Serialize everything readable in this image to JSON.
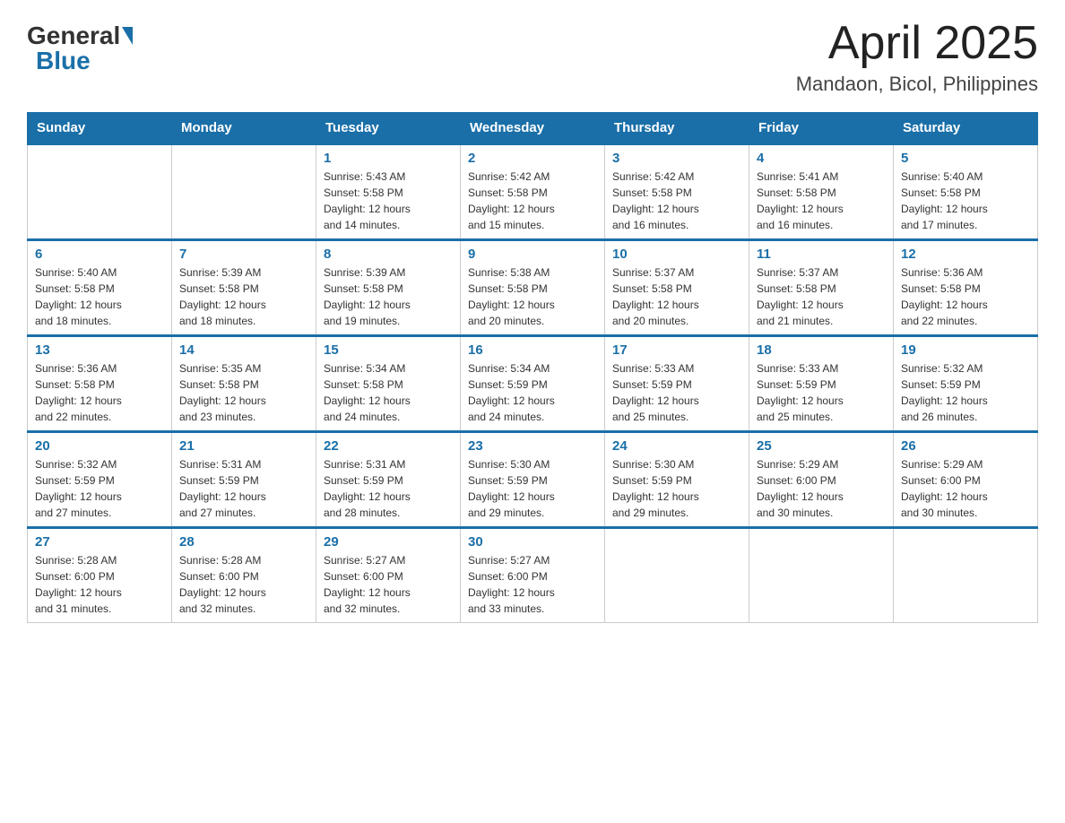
{
  "logo": {
    "general": "General",
    "blue": "Blue"
  },
  "title": "April 2025",
  "subtitle": "Mandaon, Bicol, Philippines",
  "days_of_week": [
    "Sunday",
    "Monday",
    "Tuesday",
    "Wednesday",
    "Thursday",
    "Friday",
    "Saturday"
  ],
  "weeks": [
    [
      {
        "day": null,
        "info": null
      },
      {
        "day": null,
        "info": null
      },
      {
        "day": "1",
        "info": "Sunrise: 5:43 AM\nSunset: 5:58 PM\nDaylight: 12 hours\nand 14 minutes."
      },
      {
        "day": "2",
        "info": "Sunrise: 5:42 AM\nSunset: 5:58 PM\nDaylight: 12 hours\nand 15 minutes."
      },
      {
        "day": "3",
        "info": "Sunrise: 5:42 AM\nSunset: 5:58 PM\nDaylight: 12 hours\nand 16 minutes."
      },
      {
        "day": "4",
        "info": "Sunrise: 5:41 AM\nSunset: 5:58 PM\nDaylight: 12 hours\nand 16 minutes."
      },
      {
        "day": "5",
        "info": "Sunrise: 5:40 AM\nSunset: 5:58 PM\nDaylight: 12 hours\nand 17 minutes."
      }
    ],
    [
      {
        "day": "6",
        "info": "Sunrise: 5:40 AM\nSunset: 5:58 PM\nDaylight: 12 hours\nand 18 minutes."
      },
      {
        "day": "7",
        "info": "Sunrise: 5:39 AM\nSunset: 5:58 PM\nDaylight: 12 hours\nand 18 minutes."
      },
      {
        "day": "8",
        "info": "Sunrise: 5:39 AM\nSunset: 5:58 PM\nDaylight: 12 hours\nand 19 minutes."
      },
      {
        "day": "9",
        "info": "Sunrise: 5:38 AM\nSunset: 5:58 PM\nDaylight: 12 hours\nand 20 minutes."
      },
      {
        "day": "10",
        "info": "Sunrise: 5:37 AM\nSunset: 5:58 PM\nDaylight: 12 hours\nand 20 minutes."
      },
      {
        "day": "11",
        "info": "Sunrise: 5:37 AM\nSunset: 5:58 PM\nDaylight: 12 hours\nand 21 minutes."
      },
      {
        "day": "12",
        "info": "Sunrise: 5:36 AM\nSunset: 5:58 PM\nDaylight: 12 hours\nand 22 minutes."
      }
    ],
    [
      {
        "day": "13",
        "info": "Sunrise: 5:36 AM\nSunset: 5:58 PM\nDaylight: 12 hours\nand 22 minutes."
      },
      {
        "day": "14",
        "info": "Sunrise: 5:35 AM\nSunset: 5:58 PM\nDaylight: 12 hours\nand 23 minutes."
      },
      {
        "day": "15",
        "info": "Sunrise: 5:34 AM\nSunset: 5:58 PM\nDaylight: 12 hours\nand 24 minutes."
      },
      {
        "day": "16",
        "info": "Sunrise: 5:34 AM\nSunset: 5:59 PM\nDaylight: 12 hours\nand 24 minutes."
      },
      {
        "day": "17",
        "info": "Sunrise: 5:33 AM\nSunset: 5:59 PM\nDaylight: 12 hours\nand 25 minutes."
      },
      {
        "day": "18",
        "info": "Sunrise: 5:33 AM\nSunset: 5:59 PM\nDaylight: 12 hours\nand 25 minutes."
      },
      {
        "day": "19",
        "info": "Sunrise: 5:32 AM\nSunset: 5:59 PM\nDaylight: 12 hours\nand 26 minutes."
      }
    ],
    [
      {
        "day": "20",
        "info": "Sunrise: 5:32 AM\nSunset: 5:59 PM\nDaylight: 12 hours\nand 27 minutes."
      },
      {
        "day": "21",
        "info": "Sunrise: 5:31 AM\nSunset: 5:59 PM\nDaylight: 12 hours\nand 27 minutes."
      },
      {
        "day": "22",
        "info": "Sunrise: 5:31 AM\nSunset: 5:59 PM\nDaylight: 12 hours\nand 28 minutes."
      },
      {
        "day": "23",
        "info": "Sunrise: 5:30 AM\nSunset: 5:59 PM\nDaylight: 12 hours\nand 29 minutes."
      },
      {
        "day": "24",
        "info": "Sunrise: 5:30 AM\nSunset: 5:59 PM\nDaylight: 12 hours\nand 29 minutes."
      },
      {
        "day": "25",
        "info": "Sunrise: 5:29 AM\nSunset: 6:00 PM\nDaylight: 12 hours\nand 30 minutes."
      },
      {
        "day": "26",
        "info": "Sunrise: 5:29 AM\nSunset: 6:00 PM\nDaylight: 12 hours\nand 30 minutes."
      }
    ],
    [
      {
        "day": "27",
        "info": "Sunrise: 5:28 AM\nSunset: 6:00 PM\nDaylight: 12 hours\nand 31 minutes."
      },
      {
        "day": "28",
        "info": "Sunrise: 5:28 AM\nSunset: 6:00 PM\nDaylight: 12 hours\nand 32 minutes."
      },
      {
        "day": "29",
        "info": "Sunrise: 5:27 AM\nSunset: 6:00 PM\nDaylight: 12 hours\nand 32 minutes."
      },
      {
        "day": "30",
        "info": "Sunrise: 5:27 AM\nSunset: 6:00 PM\nDaylight: 12 hours\nand 33 minutes."
      },
      {
        "day": null,
        "info": null
      },
      {
        "day": null,
        "info": null
      },
      {
        "day": null,
        "info": null
      }
    ]
  ]
}
